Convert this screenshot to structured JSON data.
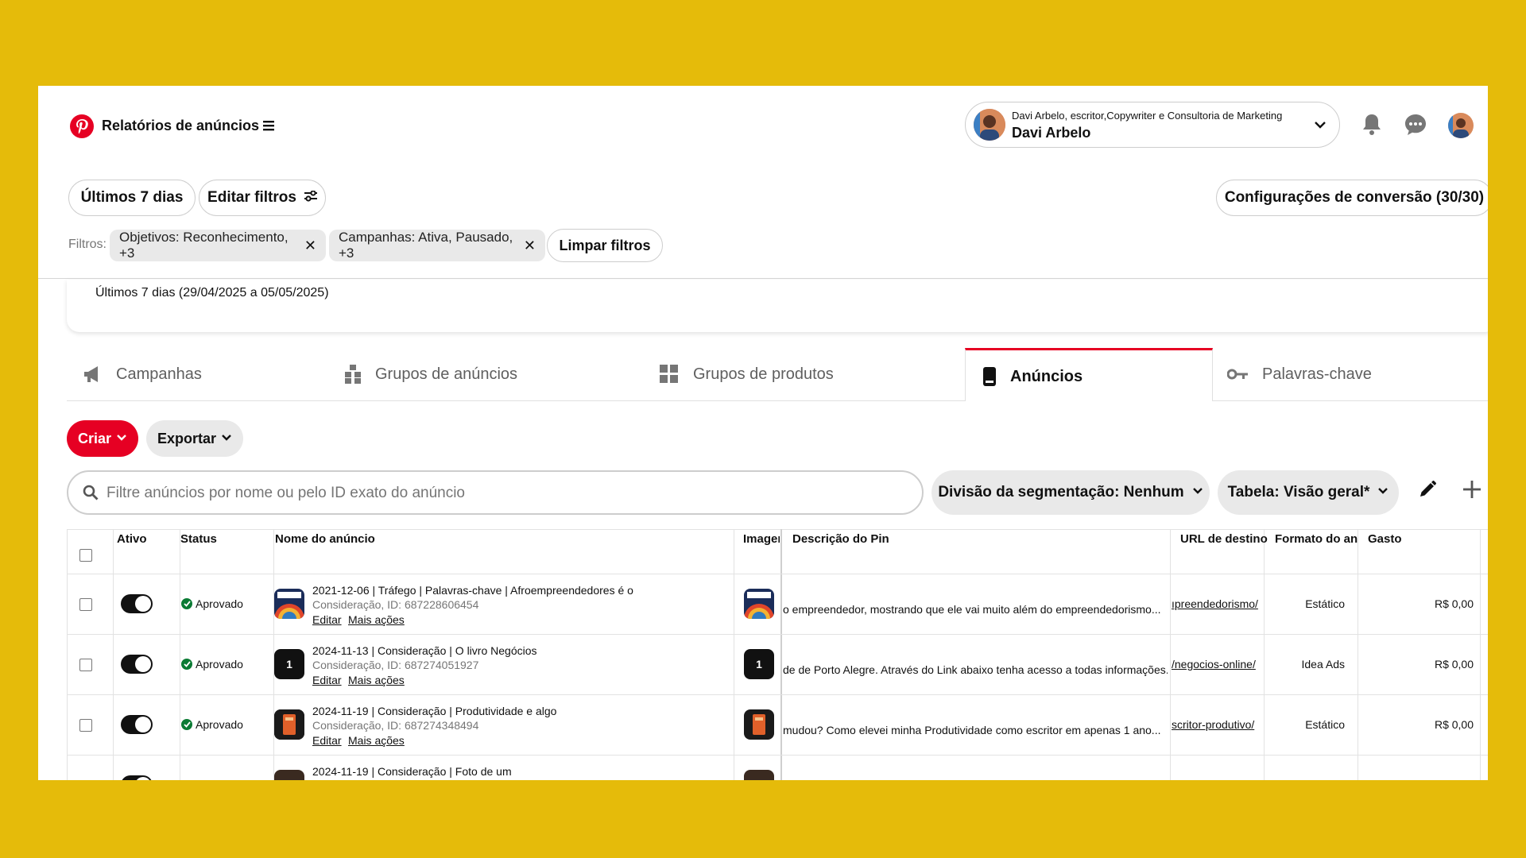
{
  "header": {
    "title": "Relatórios de anúncios",
    "account_subtitle": "Davi Arbelo, escritor,Copywriter e Consultoria de Marketing",
    "account_name": "Davi Arbelo"
  },
  "toolbar": {
    "date_button": "Últimos 7 dias",
    "edit_filters": "Editar filtros",
    "conversion_settings": "Configurações de conversão (30/30)"
  },
  "filters": {
    "label": "Filtros:",
    "chips": [
      "Objetivos: Reconhecimento, +3",
      "Campanhas: Ativa, Pausado, +3"
    ],
    "clear": "Limpar filtros"
  },
  "date_range": "Últimos 7 dias (29/04/2025 a 05/05/2025)",
  "tabs": [
    {
      "label": "Campanhas",
      "icon": "megaphone-icon"
    },
    {
      "label": "Grupos de anúncios",
      "icon": "ad-groups-icon"
    },
    {
      "label": "Grupos de produtos",
      "icon": "grid-icon"
    },
    {
      "label": "Anúncios",
      "icon": "phone-icon",
      "active": true
    },
    {
      "label": "Palavras-chave",
      "icon": "key-icon"
    }
  ],
  "actions": {
    "create": "Criar",
    "export": "Exportar"
  },
  "search": {
    "placeholder": "Filtre anúncios por nome ou pelo ID exato do anúncio"
  },
  "segmentation": "Divisão da segmentação: Nenhum",
  "table_view": "Tabela: Visão geral*",
  "colors": {
    "accent": "#E60023",
    "background": "#E5BB0A",
    "approved": "#0A7A33"
  },
  "table": {
    "headers": [
      "Ativo",
      "Status",
      "Nome do anúncio",
      "Imager",
      "Descrição do Pin",
      "URL de destino",
      "Formato do anúi",
      "Gasto"
    ],
    "rows": [
      {
        "status": "Aprovado",
        "name": "2021-12-06 | Tráfego | Palavras-chave | Afroempreendedores é o",
        "meta": "Consideração, ID: 687228606454",
        "edit": "Editar",
        "more": "Mais ações",
        "description": "o empreendedor, mostrando que ele vai muito além do empreendedorismo...",
        "url": "ıpreendedorismo/",
        "format": "Estático",
        "spend": "R$ 0,00"
      },
      {
        "status": "Aprovado",
        "name": "2024-11-13 | Consideração | O livro Negócios",
        "meta": "Consideração, ID: 687274051927",
        "edit": "Editar",
        "more": "Mais ações",
        "description": "de de Porto Alegre. Através do Link abaixo tenha acesso a todas informações.",
        "url": "/negocios-online/",
        "format": "Idea Ads",
        "spend": "R$ 0,00",
        "thumb_label": "1"
      },
      {
        "status": "Aprovado",
        "name": "2024-11-19 | Consideração | Produtividade e algo",
        "meta": "Consideração, ID: 687274348494",
        "edit": "Editar",
        "more": "Mais ações",
        "description": "mudou? Como elevei minha Produtividade como escritor em apenas 1 ano...",
        "url": "scritor-produtivo/",
        "format": "Estático",
        "spend": "R$ 0,00"
      },
      {
        "name": "2024-11-19 | Consideração | Foto de um"
      }
    ]
  }
}
